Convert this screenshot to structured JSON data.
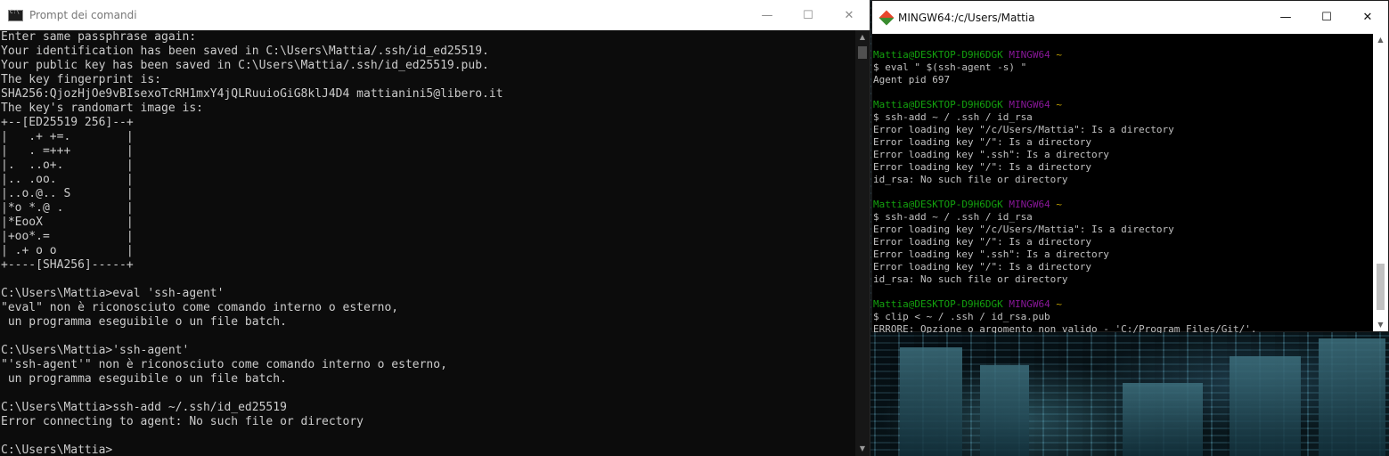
{
  "cmd_window": {
    "title": "Prompt dei comandi",
    "controls": {
      "minimize": "—",
      "maximize": "☐",
      "close": "✕"
    },
    "lines": [
      "Enter same passphrase again:",
      "Your identification has been saved in C:\\Users\\Mattia/.ssh/id_ed25519.",
      "Your public key has been saved in C:\\Users\\Mattia/.ssh/id_ed25519.pub.",
      "The key fingerprint is:",
      "SHA256:QjozHjOe9vBIsexoTcRH1mxY4jQLRuuioGiG8klJ4D4 mattianini5@libero.it",
      "The key's randomart image is:",
      "+--[ED25519 256]--+",
      "|   .+ +=.        |",
      "|   . =+++        |",
      "|.  ..o+.         |",
      "|.. .oo.          |",
      "|..o.@.. S        |",
      "|*o *.@ .         |",
      "|*EooX            |",
      "|+oo*.=           |",
      "| .+ o o          |",
      "+----[SHA256]-----+",
      "",
      "C:\\Users\\Mattia>eval 'ssh-agent'",
      "\"eval\" non è riconosciuto come comando interno o esterno,",
      " un programma eseguibile o un file batch.",
      "",
      "C:\\Users\\Mattia>'ssh-agent'",
      "\"'ssh-agent'\" non è riconosciuto come comando interno o esterno,",
      " un programma eseguibile o un file batch.",
      "",
      "C:\\Users\\Mattia>ssh-add ~/.ssh/id_ed25519",
      "Error connecting to agent: No such file or directory",
      "",
      "C:\\Users\\Mattia>"
    ]
  },
  "mingw_window": {
    "title": "MINGW64:/c/Users/Mattia",
    "controls": {
      "minimize": "—",
      "maximize": "☐",
      "close": "✕"
    },
    "prompt_user": "Mattia@DESKTOP-D9H6DGK",
    "prompt_host": "MINGW64",
    "prompt_path": "~",
    "blocks": [
      {
        "command": "$ eval \" $(ssh-agent -s) \"",
        "output": [
          "Agent pid 697"
        ]
      },
      {
        "command": "$ ssh-add ~ / .ssh / id_rsa",
        "output": [
          "Error loading key \"/c/Users/Mattia\": Is a directory",
          "Error loading key \"/\": Is a directory",
          "Error loading key \".ssh\": Is a directory",
          "Error loading key \"/\": Is a directory",
          "id_rsa: No such file or directory"
        ]
      },
      {
        "command": "$ ssh-add ~ / .ssh / id_rsa",
        "output": [
          "Error loading key \"/c/Users/Mattia\": Is a directory",
          "Error loading key \"/\": Is a directory",
          "Error loading key \".ssh\": Is a directory",
          "Error loading key \"/\": Is a directory",
          "id_rsa: No such file or directory"
        ]
      },
      {
        "command": "$ clip < ~ / .ssh / id_rsa.pub",
        "output": [
          "ERRORE: Opzione o argomento non valido - 'C:/Program Files/Git/'."
        ]
      }
    ]
  },
  "colors": {
    "cmd_bg": "#0c0c0c",
    "cmd_text": "#cccccc",
    "mingw_bg": "#000000",
    "mingw_user": "#13a10e",
    "mingw_host": "#881798"
  }
}
